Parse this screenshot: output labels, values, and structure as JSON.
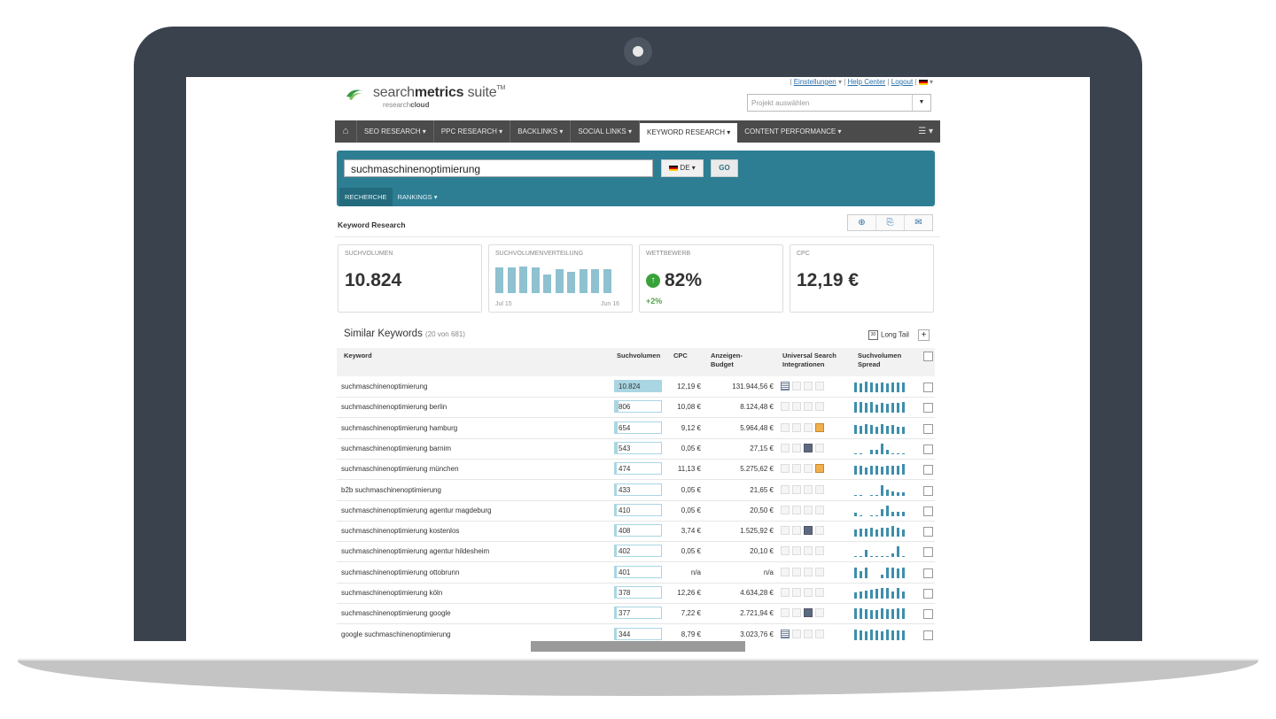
{
  "header": {
    "logo_prefix": "search",
    "logo_bold": "metrics",
    "logo_suffix": " suite",
    "logo_tm": "TM",
    "logo_sub_prefix": "research",
    "logo_sub_bold": "cloud",
    "links": {
      "settings": "Einstellungen",
      "help": "Help Center",
      "logout": "Logout"
    },
    "project_placeholder": "Projekt auswählen"
  },
  "nav": {
    "items": [
      {
        "label": "SEO RESEARCH",
        "active": false
      },
      {
        "label": "PPC RESEARCH",
        "active": false
      },
      {
        "label": "BACKLINKS",
        "active": false
      },
      {
        "label": "SOCIAL LINKS",
        "active": false
      },
      {
        "label": "KEYWORD RESEARCH",
        "active": true
      },
      {
        "label": "CONTENT PERFORMANCE",
        "active": false
      }
    ]
  },
  "search": {
    "query": "suchmaschinenoptimierung",
    "lang": "DE",
    "go": "GO",
    "tabs": [
      "RECHERCHE",
      "RANKINGS"
    ]
  },
  "section_title": "Keyword Research",
  "metrics": {
    "volume_label": "SUCHVOLUMEN",
    "volume_value": "10.824",
    "distribution_label": "SUCHVOLUMENVERTEILUNG",
    "distribution_from": "Jul 15",
    "distribution_to": "Jun 16",
    "distribution_values": [
      0.9,
      0.9,
      0.95,
      0.9,
      0.65,
      0.85,
      0.75,
      0.85,
      0.85,
      0.85
    ],
    "competition_label": "WETTBEWERB",
    "competition_value": "82%",
    "competition_change": "+2%",
    "cpc_label": "CPC",
    "cpc_value": "12,19 €"
  },
  "similar": {
    "title": "Similar Keywords",
    "count": "(20 von 681)",
    "longtail_label": "Long Tail",
    "columns": {
      "keyword": "Keyword",
      "volume": "Suchvolumen",
      "cpc": "CPC",
      "budget_1": "Anzeigen-",
      "budget_2": "Budget",
      "universal_1": "Universal Search",
      "universal_2": "Integrationen",
      "spread_1": "Suchvolumen",
      "spread_2": "Spread"
    },
    "rows": [
      {
        "keyword": "suchmaschinenoptimierung",
        "volume": "10.824",
        "fill": 1.0,
        "cpc": "12,19 €",
        "budget": "131.944,56 €",
        "us": [
          "news",
          "off",
          "off",
          "off"
        ],
        "spread": [
          0.85,
          0.8,
          0.9,
          0.85,
          0.75,
          0.85,
          0.8,
          0.85,
          0.85,
          0.85
        ]
      },
      {
        "keyword": "suchmaschinenoptimierung berlin",
        "volume": "806",
        "fill": 0.07,
        "cpc": "10,08 €",
        "budget": "8.124,48 €",
        "us": [
          "off",
          "off",
          "off",
          "off"
        ],
        "spread": [
          0.9,
          0.95,
          0.85,
          0.9,
          0.7,
          0.85,
          0.8,
          0.85,
          0.85,
          0.9
        ]
      },
      {
        "keyword": "suchmaschinenoptimierung hamburg",
        "volume": "654",
        "fill": 0.06,
        "cpc": "9,12 €",
        "budget": "5.964,48 €",
        "us": [
          "off",
          "off",
          "off",
          "image"
        ],
        "spread": [
          0.75,
          0.7,
          0.85,
          0.75,
          0.6,
          0.85,
          0.7,
          0.75,
          0.65,
          0.65
        ]
      },
      {
        "keyword": "suchmaschinenoptimierung barnim",
        "volume": "543",
        "fill": 0.05,
        "cpc": "0,05 €",
        "budget": "27,15 €",
        "us": [
          "off",
          "off",
          "video",
          "off"
        ],
        "spread": [
          0.1,
          0.1,
          0,
          0.35,
          0.35,
          0.9,
          0.4,
          0.1,
          0.1,
          0.1
        ]
      },
      {
        "keyword": "suchmaschinenoptimierung münchen",
        "volume": "474",
        "fill": 0.045,
        "cpc": "11,13 €",
        "budget": "5.275,62 €",
        "us": [
          "off",
          "off",
          "off",
          "image"
        ],
        "spread": [
          0.8,
          0.75,
          0.65,
          0.8,
          0.75,
          0.7,
          0.75,
          0.8,
          0.75,
          0.95
        ]
      },
      {
        "keyword": "b2b suchmaschinenoptimierung",
        "volume": "433",
        "fill": 0.04,
        "cpc": "0,05 €",
        "budget": "21,65 €",
        "us": [
          "off",
          "off",
          "off",
          "off"
        ],
        "spread": [
          0.1,
          0.1,
          0,
          0.1,
          0.1,
          0.95,
          0.5,
          0.4,
          0.3,
          0.3
        ]
      },
      {
        "keyword": "suchmaschinenoptimierung agentur magdeburg",
        "volume": "410",
        "fill": 0.038,
        "cpc": "0,05 €",
        "budget": "20,50 €",
        "us": [
          "off",
          "off",
          "off",
          "off"
        ],
        "spread": [
          0.3,
          0.1,
          0,
          0.1,
          0.1,
          0.6,
          0.95,
          0.4,
          0.4,
          0.4
        ]
      },
      {
        "keyword": "suchmaschinenoptimierung kostenlos",
        "volume": "408",
        "fill": 0.038,
        "cpc": "3,74 €",
        "budget": "1.525,92 €",
        "us": [
          "off",
          "off",
          "video",
          "off"
        ],
        "spread": [
          0.6,
          0.7,
          0.7,
          0.75,
          0.65,
          0.75,
          0.8,
          0.95,
          0.8,
          0.6
        ]
      },
      {
        "keyword": "suchmaschinenoptimierung agentur hildesheim",
        "volume": "402",
        "fill": 0.037,
        "cpc": "0,05 €",
        "budget": "20,10 €",
        "us": [
          "off",
          "off",
          "off",
          "off"
        ],
        "spread": [
          0.1,
          0.1,
          0.6,
          0.1,
          0.1,
          0.1,
          0.1,
          0.3,
          0.95,
          0.1
        ]
      },
      {
        "keyword": "suchmaschinenoptimierung ottobrunn",
        "volume": "401",
        "fill": 0.037,
        "cpc": "n/a",
        "budget": "n/a",
        "us": [
          "off",
          "off",
          "off",
          "off"
        ],
        "spread": [
          0.95,
          0.6,
          0.9,
          0,
          0,
          0.3,
          0.95,
          0.9,
          0.85,
          0.9
        ]
      },
      {
        "keyword": "suchmaschinenoptimierung köln",
        "volume": "378",
        "fill": 0.035,
        "cpc": "12,26 €",
        "budget": "4.634,28 €",
        "us": [
          "off",
          "off",
          "off",
          "off"
        ],
        "spread": [
          0.55,
          0.6,
          0.7,
          0.8,
          0.85,
          0.9,
          0.95,
          0.65,
          0.9,
          0.6
        ]
      },
      {
        "keyword": "suchmaschinenoptimierung google",
        "volume": "377",
        "fill": 0.035,
        "cpc": "7,22 €",
        "budget": "2.721,94 €",
        "us": [
          "off",
          "off",
          "video",
          "off"
        ],
        "spread": [
          0.95,
          0.9,
          0.85,
          0.8,
          0.75,
          0.95,
          0.85,
          0.85,
          0.9,
          0.9
        ]
      },
      {
        "keyword": "google suchmaschinenoptimierung",
        "volume": "344",
        "fill": 0.032,
        "cpc": "8,79 €",
        "budget": "3.023,76 €",
        "us": [
          "news",
          "off",
          "off",
          "off"
        ],
        "spread": [
          0.9,
          0.85,
          0.8,
          0.95,
          0.85,
          0.75,
          0.9,
          0.85,
          0.85,
          0.85
        ]
      }
    ]
  }
}
